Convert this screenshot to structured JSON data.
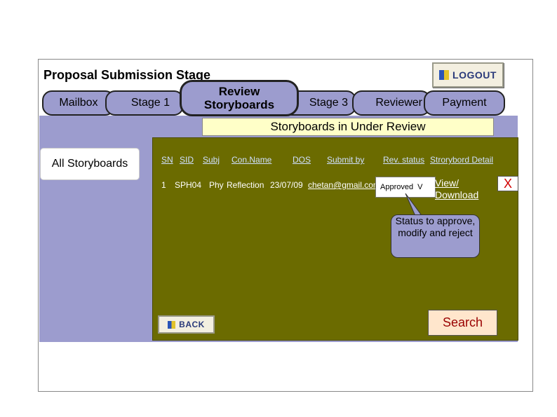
{
  "header": {
    "title": "Proposal Submission Stage",
    "logout_label": "LOGOUT"
  },
  "tabs": [
    {
      "label": "Mailbox"
    },
    {
      "label": "Stage 1"
    },
    {
      "label": "Review Storyboards",
      "active": true
    },
    {
      "label": "Stage 3"
    },
    {
      "label": "Reviewer"
    },
    {
      "label": "Payment"
    }
  ],
  "sidebar": {
    "all_storyboards": "All Storyboards"
  },
  "panel": {
    "title": "Storyboards in Under Review"
  },
  "table": {
    "headers": [
      "SN",
      "SID",
      "Subj",
      "Con.Name",
      "DOS",
      "Submit by",
      "Rev. status",
      "Strorybord Detail"
    ],
    "rows": [
      {
        "sn": "1",
        "sid": "SPH04",
        "subj": "Phy",
        "con_name": "Reflection",
        "dos": "23/07/09",
        "submit_by": "chetan@gmail.com",
        "rev_status": "Approved",
        "detail": "View/ Download"
      }
    ],
    "select_arrow": "V",
    "close": "X"
  },
  "callout": {
    "text": "Status to approve, modify and reject"
  },
  "buttons": {
    "search": "Search",
    "back": "BACK"
  },
  "colors": {
    "nav": "#9c9cce",
    "content_bg": "#6b6b00",
    "title_bg": "#ffffc8",
    "search_text": "#990000"
  }
}
